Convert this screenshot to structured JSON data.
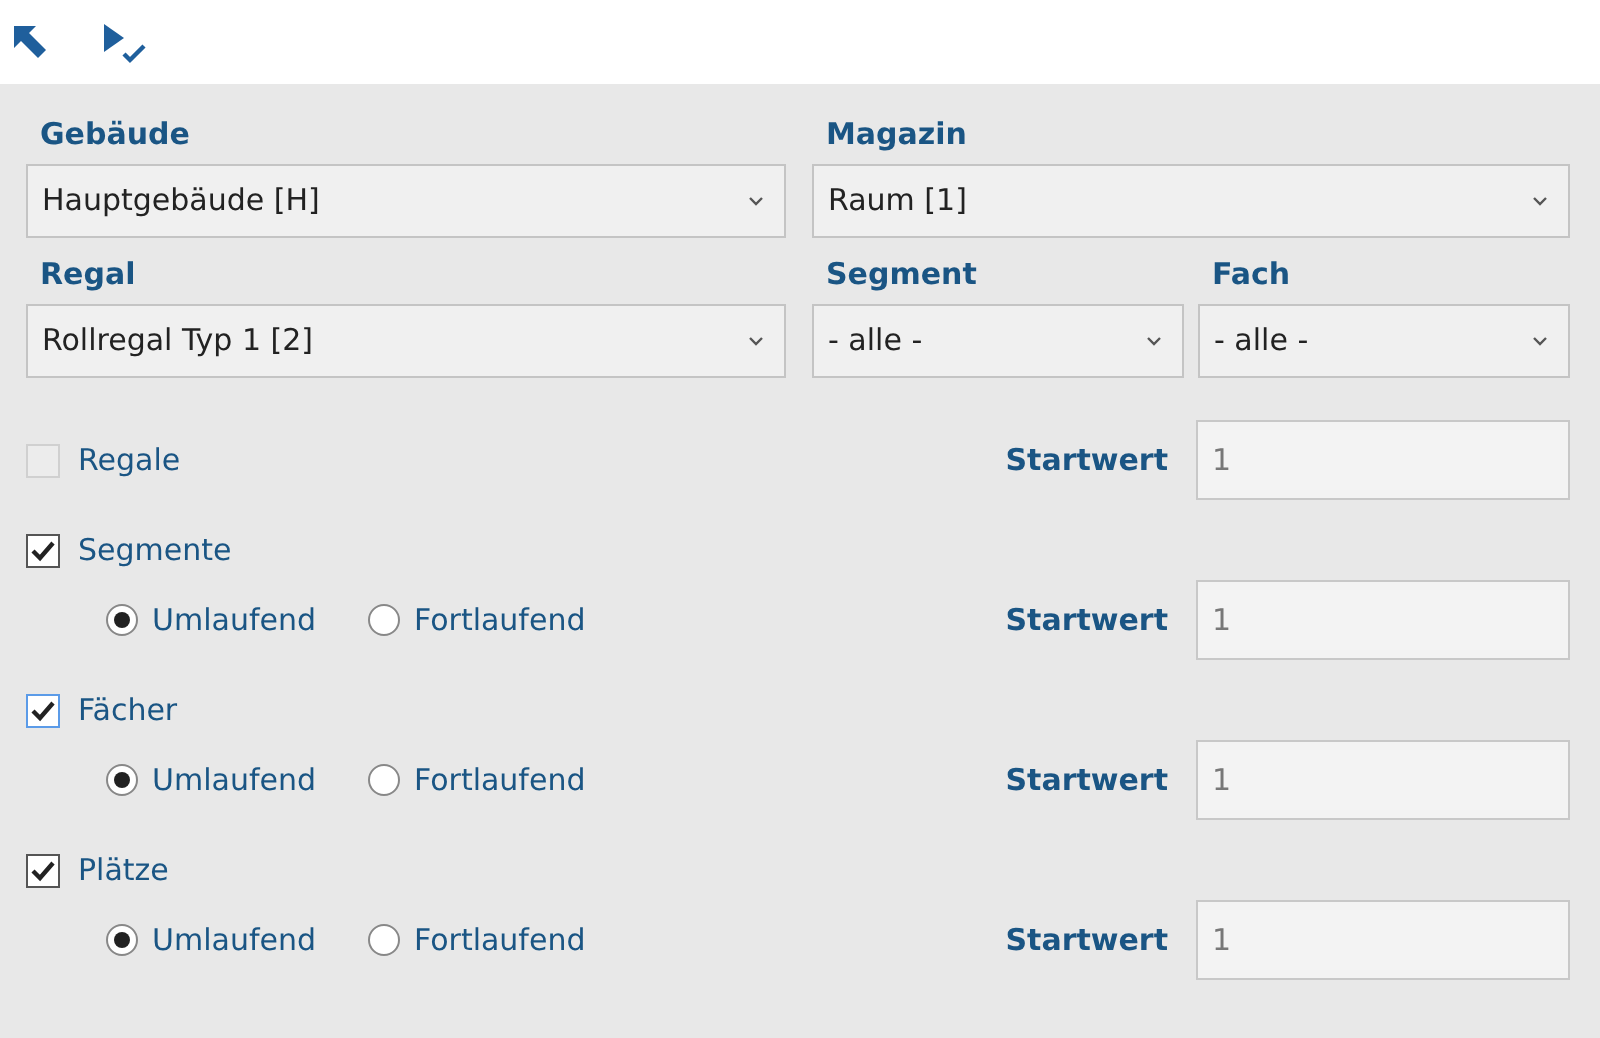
{
  "toolbar": {
    "buttons": [
      {
        "kind": "arrow"
      },
      {
        "kind": "run-check"
      }
    ]
  },
  "select_rows": [
    {
      "left": {
        "label": "Gebäude",
        "value": "Hauptgebäude [H]"
      },
      "right": [
        {
          "label": "Magazin",
          "value": "Raum [1]"
        }
      ]
    },
    {
      "left": {
        "label": "Regal",
        "value": "Rollregal Typ 1 [2]"
      },
      "right": [
        {
          "label": "Segment",
          "value": "- alle -"
        },
        {
          "label": "Fach",
          "value": "- alle -"
        }
      ]
    }
  ],
  "options": [
    {
      "label": "Regale",
      "checked": false,
      "disabled": true,
      "focused": false,
      "start_label": "Startwert",
      "start_value": "1"
    },
    {
      "label": "Segmente",
      "checked": true,
      "disabled": false,
      "focused": false,
      "radios": [
        {
          "label": "Umlaufend",
          "selected": true
        },
        {
          "label": "Fortlaufend",
          "selected": false
        }
      ],
      "start_label": "Startwert",
      "start_value": "1"
    },
    {
      "label": "Fächer",
      "checked": true,
      "disabled": false,
      "focused": true,
      "radios": [
        {
          "label": "Umlaufend",
          "selected": true
        },
        {
          "label": "Fortlaufend",
          "selected": false
        }
      ],
      "start_label": "Startwert",
      "start_value": "1"
    },
    {
      "label": "Plätze",
      "checked": true,
      "disabled": false,
      "focused": false,
      "radios": [
        {
          "label": "Umlaufend",
          "selected": true
        },
        {
          "label": "Fortlaufend",
          "selected": false
        }
      ],
      "start_label": "Startwert",
      "start_value": "1"
    }
  ]
}
